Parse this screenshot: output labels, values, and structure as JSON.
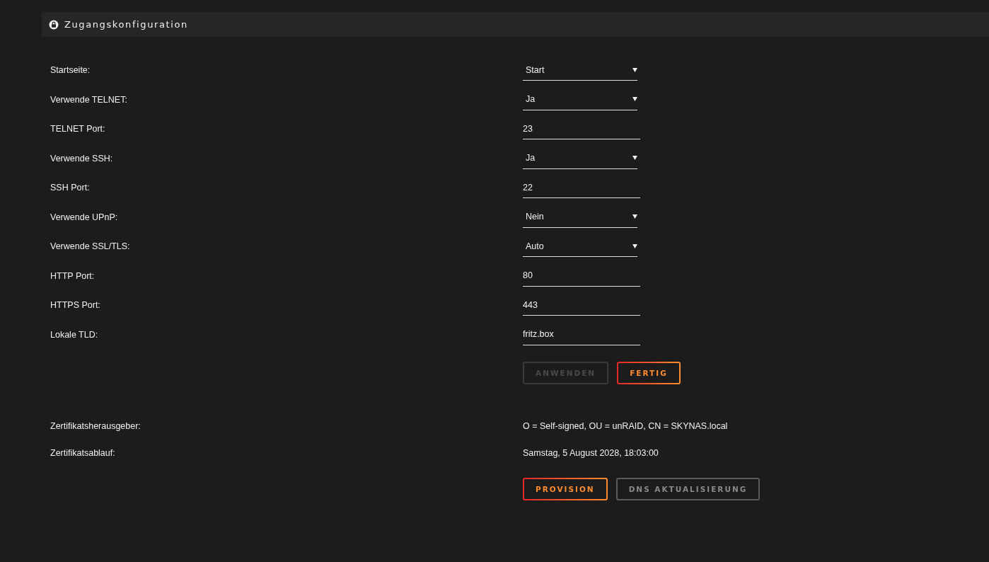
{
  "header": {
    "title": "Zugangskonfiguration"
  },
  "settings": [
    {
      "label": "Startseite:",
      "kind": "select",
      "value": "Start"
    },
    {
      "label": "Verwende TELNET:",
      "kind": "select",
      "value": "Ja"
    },
    {
      "label": "TELNET Port:",
      "kind": "input",
      "value": "23"
    },
    {
      "label": "Verwende SSH:",
      "kind": "select",
      "value": "Ja"
    },
    {
      "label": "SSH Port:",
      "kind": "input",
      "value": "22"
    },
    {
      "label": "Verwende UPnP:",
      "kind": "select",
      "value": "Nein"
    },
    {
      "label": "Verwende SSL/TLS:",
      "kind": "select",
      "value": "Auto"
    },
    {
      "label": "HTTP Port:",
      "kind": "input",
      "value": "80"
    },
    {
      "label": "HTTPS Port:",
      "kind": "input",
      "value": "443"
    },
    {
      "label": "Lokale TLD:",
      "kind": "input",
      "value": "fritz.box"
    }
  ],
  "settings_buttons": [
    {
      "label": "ANWENDEN",
      "kind": "disabled"
    },
    {
      "label": "FERTIG",
      "kind": "primary"
    }
  ],
  "certificate": [
    {
      "label": "Zertifikatsherausgeber:",
      "value": "O = Self-signed, OU = unRAID, CN = SKYNAS.local"
    },
    {
      "label": "Zertifikatsablauf:",
      "value": "Samstag, 5 August 2028, 18:03:00"
    }
  ],
  "certificate_buttons": [
    {
      "label": "PROVISION",
      "kind": "primary"
    },
    {
      "label": "DNS AKTUALISIERUNG",
      "kind": "secondary"
    }
  ]
}
